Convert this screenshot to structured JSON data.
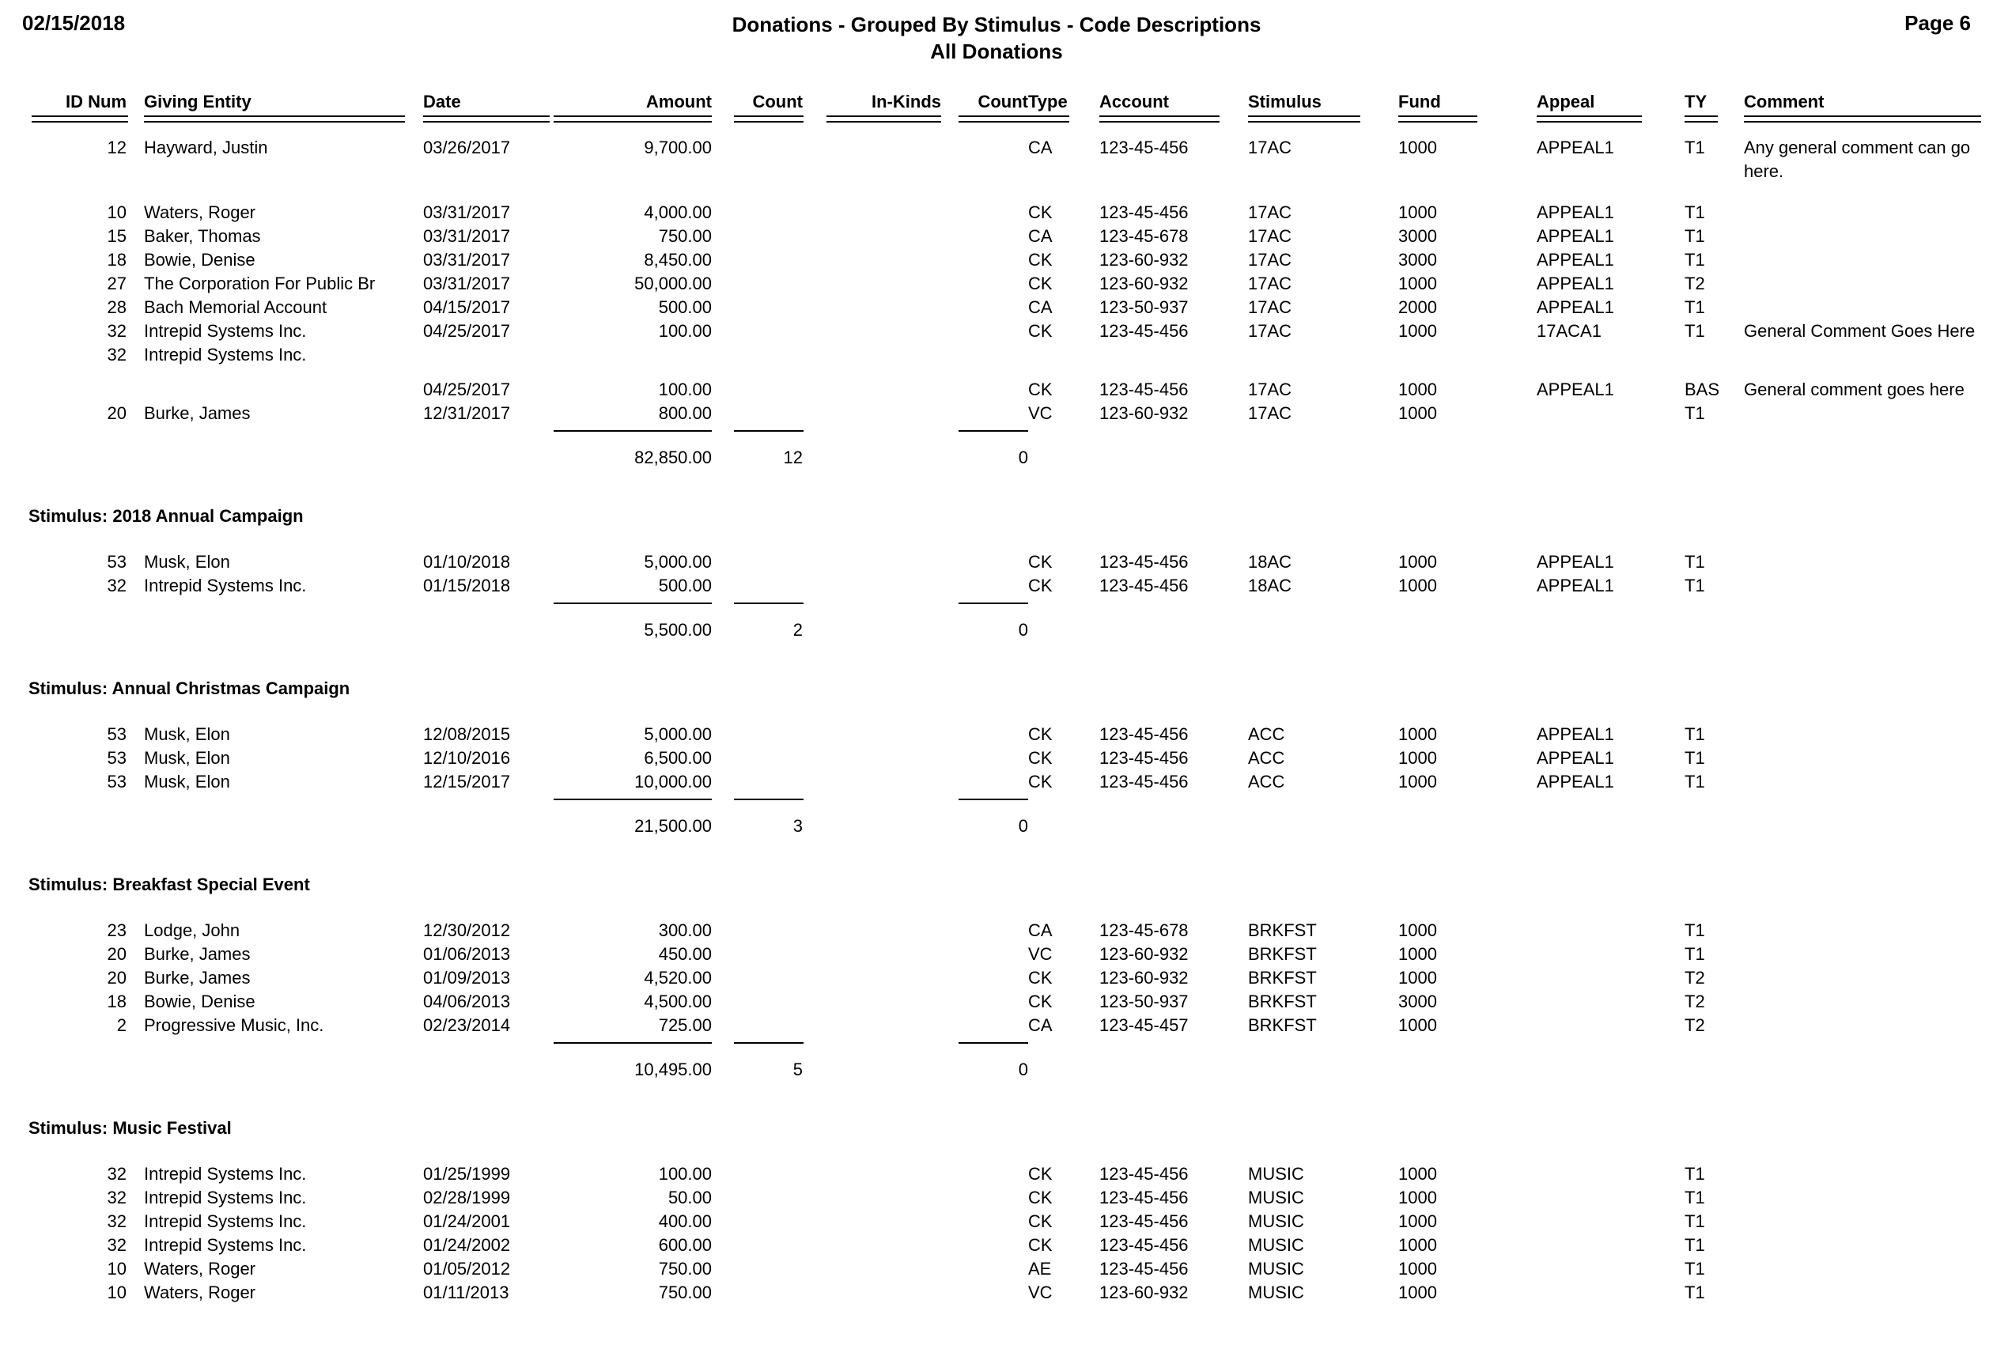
{
  "header": {
    "date": "02/15/2018",
    "title": "Donations - Grouped By Stimulus - Code Descriptions",
    "subtitle": "All Donations",
    "page_label": "Page 6"
  },
  "columns": {
    "id_num": "ID Num",
    "giving_entity": "Giving Entity",
    "date": "Date",
    "amount": "Amount",
    "count1": "Count",
    "in_kinds": "In-Kinds",
    "count2": "Count",
    "type": "Type",
    "account": "Account",
    "stimulus": "Stimulus",
    "fund": "Fund",
    "appeal": "Appeal",
    "ty": "TY",
    "comment": "Comment"
  },
  "groups": [
    {
      "title": "",
      "has_title": false,
      "rows": [
        {
          "id_num": "12",
          "entity": "Hayward, Justin",
          "date": "03/26/2017",
          "amount": "9,700.00",
          "count1": "",
          "in_kinds": "",
          "count2": "",
          "type": "CA",
          "account": "123-45-456",
          "stimulus": "17AC",
          "fund": "1000",
          "appeal": "APPEAL1",
          "ty": "T1",
          "comment": "Any general comment can go here.",
          "gap_after": 22
        },
        {
          "id_num": "10",
          "entity": "Waters, Roger",
          "date": "03/31/2017",
          "amount": "4,000.00",
          "count1": "",
          "in_kinds": "",
          "count2": "",
          "type": "CK",
          "account": "123-45-456",
          "stimulus": "17AC",
          "fund": "1000",
          "appeal": "APPEAL1",
          "ty": "T1",
          "comment": "",
          "gap_after": 0
        },
        {
          "id_num": "15",
          "entity": "Baker, Thomas",
          "date": "03/31/2017",
          "amount": "750.00",
          "count1": "",
          "in_kinds": "",
          "count2": "",
          "type": "CA",
          "account": "123-45-678",
          "stimulus": "17AC",
          "fund": "3000",
          "appeal": "APPEAL1",
          "ty": "T1",
          "comment": "",
          "gap_after": 0
        },
        {
          "id_num": "18",
          "entity": "Bowie, Denise",
          "date": "03/31/2017",
          "amount": "8,450.00",
          "count1": "",
          "in_kinds": "",
          "count2": "",
          "type": "CK",
          "account": "123-60-932",
          "stimulus": "17AC",
          "fund": "3000",
          "appeal": "APPEAL1",
          "ty": "T1",
          "comment": "",
          "gap_after": 0
        },
        {
          "id_num": "27",
          "entity": "The Corporation For Public Br",
          "date": "03/31/2017",
          "amount": "50,000.00",
          "count1": "",
          "in_kinds": "",
          "count2": "",
          "type": "CK",
          "account": "123-60-932",
          "stimulus": "17AC",
          "fund": "1000",
          "appeal": "APPEAL1",
          "ty": "T2",
          "comment": "",
          "gap_after": 0
        },
        {
          "id_num": "28",
          "entity": "Bach Memorial Account",
          "date": "04/15/2017",
          "amount": "500.00",
          "count1": "",
          "in_kinds": "",
          "count2": "",
          "type": "CA",
          "account": "123-50-937",
          "stimulus": "17AC",
          "fund": "2000",
          "appeal": "APPEAL1",
          "ty": "T1",
          "comment": "",
          "gap_after": 0
        },
        {
          "id_num": "32",
          "entity": "Intrepid Systems Inc.",
          "date": "04/25/2017",
          "amount": "100.00",
          "count1": "",
          "in_kinds": "",
          "count2": "",
          "type": "CK",
          "account": "123-45-456",
          "stimulus": "17AC",
          "fund": "1000",
          "appeal": "17ACA1",
          "ty": "T1",
          "comment": "General Comment Goes Here",
          "gap_after": 0
        },
        {
          "id_num": "32",
          "entity": "Intrepid Systems Inc.",
          "date": "",
          "amount": "",
          "count1": "",
          "in_kinds": "",
          "count2": "",
          "type": "",
          "account": "",
          "stimulus": "",
          "fund": "",
          "appeal": "",
          "ty": "",
          "comment": "",
          "gap_after": 14
        },
        {
          "id_num": "",
          "entity": "",
          "date": "04/25/2017",
          "amount": "100.00",
          "count1": "",
          "in_kinds": "",
          "count2": "",
          "type": "CK",
          "account": "123-45-456",
          "stimulus": "17AC",
          "fund": "1000",
          "appeal": "APPEAL1",
          "ty": "BAS",
          "comment": "General comment goes here",
          "gap_after": 0
        },
        {
          "id_num": "20",
          "entity": "Burke, James",
          "date": "12/31/2017",
          "amount": "800.00",
          "count1": "",
          "in_kinds": "",
          "count2": "",
          "type": "VC",
          "account": "123-60-932",
          "stimulus": "17AC",
          "fund": "1000",
          "appeal": "",
          "ty": "T1",
          "comment": "",
          "gap_after": 0
        }
      ],
      "subtotal": {
        "amount": "82,850.00",
        "count1": "12",
        "count2": "0"
      }
    },
    {
      "title": "Stimulus: 2018 Annual Campaign",
      "has_title": true,
      "rows": [
        {
          "id_num": "53",
          "entity": "Musk, Elon",
          "date": "01/10/2018",
          "amount": "5,000.00",
          "count1": "",
          "in_kinds": "",
          "count2": "",
          "type": "CK",
          "account": "123-45-456",
          "stimulus": "18AC",
          "fund": "1000",
          "appeal": "APPEAL1",
          "ty": "T1",
          "comment": "",
          "gap_after": 0
        },
        {
          "id_num": "32",
          "entity": "Intrepid Systems Inc.",
          "date": "01/15/2018",
          "amount": "500.00",
          "count1": "",
          "in_kinds": "",
          "count2": "",
          "type": "CK",
          "account": "123-45-456",
          "stimulus": "18AC",
          "fund": "1000",
          "appeal": "APPEAL1",
          "ty": "T1",
          "comment": "",
          "gap_after": 0
        }
      ],
      "subtotal": {
        "amount": "5,500.00",
        "count1": "2",
        "count2": "0"
      }
    },
    {
      "title": "Stimulus: Annual Christmas Campaign",
      "has_title": true,
      "rows": [
        {
          "id_num": "53",
          "entity": "Musk, Elon",
          "date": "12/08/2015",
          "amount": "5,000.00",
          "count1": "",
          "in_kinds": "",
          "count2": "",
          "type": "CK",
          "account": "123-45-456",
          "stimulus": "ACC",
          "fund": "1000",
          "appeal": "APPEAL1",
          "ty": "T1",
          "comment": "",
          "gap_after": 0
        },
        {
          "id_num": "53",
          "entity": "Musk, Elon",
          "date": "12/10/2016",
          "amount": "6,500.00",
          "count1": "",
          "in_kinds": "",
          "count2": "",
          "type": "CK",
          "account": "123-45-456",
          "stimulus": "ACC",
          "fund": "1000",
          "appeal": "APPEAL1",
          "ty": "T1",
          "comment": "",
          "gap_after": 0
        },
        {
          "id_num": "53",
          "entity": "Musk, Elon",
          "date": "12/15/2017",
          "amount": "10,000.00",
          "count1": "",
          "in_kinds": "",
          "count2": "",
          "type": "CK",
          "account": "123-45-456",
          "stimulus": "ACC",
          "fund": "1000",
          "appeal": "APPEAL1",
          "ty": "T1",
          "comment": "",
          "gap_after": 0
        }
      ],
      "subtotal": {
        "amount": "21,500.00",
        "count1": "3",
        "count2": "0"
      }
    },
    {
      "title": "Stimulus: Breakfast Special Event",
      "has_title": true,
      "rows": [
        {
          "id_num": "23",
          "entity": "Lodge, John",
          "date": "12/30/2012",
          "amount": "300.00",
          "count1": "",
          "in_kinds": "",
          "count2": "",
          "type": "CA",
          "account": "123-45-678",
          "stimulus": "BRKFST",
          "fund": "1000",
          "appeal": "",
          "ty": "T1",
          "comment": "",
          "gap_after": 0
        },
        {
          "id_num": "20",
          "entity": "Burke, James",
          "date": "01/06/2013",
          "amount": "450.00",
          "count1": "",
          "in_kinds": "",
          "count2": "",
          "type": "VC",
          "account": "123-60-932",
          "stimulus": "BRKFST",
          "fund": "1000",
          "appeal": "",
          "ty": "T1",
          "comment": "",
          "gap_after": 0
        },
        {
          "id_num": "20",
          "entity": "Burke, James",
          "date": "01/09/2013",
          "amount": "4,520.00",
          "count1": "",
          "in_kinds": "",
          "count2": "",
          "type": "CK",
          "account": "123-60-932",
          "stimulus": "BRKFST",
          "fund": "1000",
          "appeal": "",
          "ty": "T2",
          "comment": "",
          "gap_after": 0
        },
        {
          "id_num": "18",
          "entity": "Bowie, Denise",
          "date": "04/06/2013",
          "amount": "4,500.00",
          "count1": "",
          "in_kinds": "",
          "count2": "",
          "type": "CK",
          "account": "123-50-937",
          "stimulus": "BRKFST",
          "fund": "3000",
          "appeal": "",
          "ty": "T2",
          "comment": "",
          "gap_after": 0
        },
        {
          "id_num": "2",
          "entity": "Progressive Music, Inc.",
          "date": "02/23/2014",
          "amount": "725.00",
          "count1": "",
          "in_kinds": "",
          "count2": "",
          "type": "CA",
          "account": "123-45-457",
          "stimulus": "BRKFST",
          "fund": "1000",
          "appeal": "",
          "ty": "T2",
          "comment": "",
          "gap_after": 0
        }
      ],
      "subtotal": {
        "amount": "10,495.00",
        "count1": "5",
        "count2": "0"
      }
    },
    {
      "title": "Stimulus: Music Festival",
      "has_title": true,
      "rows": [
        {
          "id_num": "32",
          "entity": "Intrepid Systems Inc.",
          "date": "01/25/1999",
          "amount": "100.00",
          "count1": "",
          "in_kinds": "",
          "count2": "",
          "type": "CK",
          "account": "123-45-456",
          "stimulus": "MUSIC",
          "fund": "1000",
          "appeal": "",
          "ty": "T1",
          "comment": "",
          "gap_after": 0
        },
        {
          "id_num": "32",
          "entity": "Intrepid Systems Inc.",
          "date": "02/28/1999",
          "amount": "50.00",
          "count1": "",
          "in_kinds": "",
          "count2": "",
          "type": "CK",
          "account": "123-45-456",
          "stimulus": "MUSIC",
          "fund": "1000",
          "appeal": "",
          "ty": "T1",
          "comment": "",
          "gap_after": 0
        },
        {
          "id_num": "32",
          "entity": "Intrepid Systems Inc.",
          "date": "01/24/2001",
          "amount": "400.00",
          "count1": "",
          "in_kinds": "",
          "count2": "",
          "type": "CK",
          "account": "123-45-456",
          "stimulus": "MUSIC",
          "fund": "1000",
          "appeal": "",
          "ty": "T1",
          "comment": "",
          "gap_after": 0
        },
        {
          "id_num": "32",
          "entity": "Intrepid Systems Inc.",
          "date": "01/24/2002",
          "amount": "600.00",
          "count1": "",
          "in_kinds": "",
          "count2": "",
          "type": "CK",
          "account": "123-45-456",
          "stimulus": "MUSIC",
          "fund": "1000",
          "appeal": "",
          "ty": "T1",
          "comment": "",
          "gap_after": 0
        },
        {
          "id_num": "10",
          "entity": "Waters, Roger",
          "date": "01/05/2012",
          "amount": "750.00",
          "count1": "",
          "in_kinds": "",
          "count2": "",
          "type": "AE",
          "account": "123-45-456",
          "stimulus": "MUSIC",
          "fund": "1000",
          "appeal": "",
          "ty": "T1",
          "comment": "",
          "gap_after": 0
        },
        {
          "id_num": "10",
          "entity": "Waters, Roger",
          "date": "01/11/2013",
          "amount": "750.00",
          "count1": "",
          "in_kinds": "",
          "count2": "",
          "type": "VC",
          "account": "123-60-932",
          "stimulus": "MUSIC",
          "fund": "1000",
          "appeal": "",
          "ty": "T1",
          "comment": "",
          "gap_after": 0
        }
      ],
      "subtotal": null
    }
  ]
}
